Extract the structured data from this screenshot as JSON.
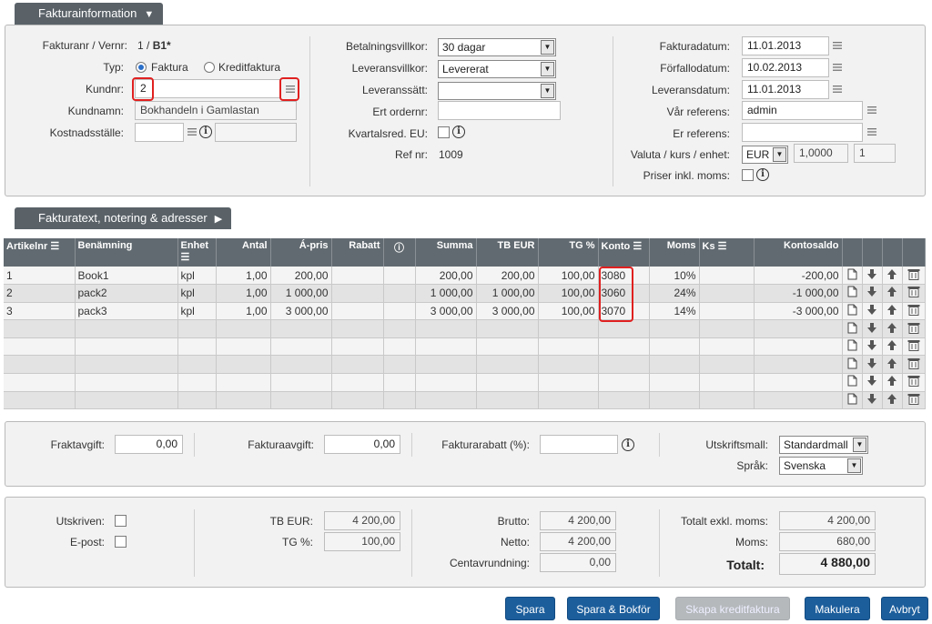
{
  "sections": {
    "info_tab": "Fakturainformation",
    "text_tab": "Fakturatext, notering & adresser"
  },
  "info": {
    "invoice_label": "Fakturanr / Vernr:",
    "invoice_num": "1 / ",
    "invoice_series": "B1*",
    "type_label": "Typ:",
    "type_faktura": "Faktura",
    "type_kredit": "Kreditfaktura",
    "kundnr_label": "Kundnr:",
    "kundnr_value": "2",
    "kundnamn_label": "Kundnamn:",
    "kundnamn_value": "Bokhandeln i Gamlastan",
    "kostnad_label": "Kostnadsställe:",
    "betal_label": "Betalningsvillkor:",
    "betal_value": "30 dagar",
    "levvill_label": "Leveransvillkor:",
    "levvill_value": "Levererat",
    "levsatt_label": "Leveranssätt:",
    "levsatt_value": "",
    "ertorder_label": "Ert ordernr:",
    "kvartal_label": "Kvartalsred. EU:",
    "refnr_label": "Ref nr:",
    "refnr_value": "1009",
    "fakturadatum_label": "Fakturadatum:",
    "fakturadatum_value": "11.01.2013",
    "forfall_label": "Förfallodatum:",
    "forfall_value": "10.02.2013",
    "levdatum_label": "Leveransdatum:",
    "levdatum_value": "11.01.2013",
    "varref_label": "Vår referens:",
    "varref_value": "admin",
    "erref_label": "Er referens:",
    "valuta_label": "Valuta / kurs / enhet:",
    "valuta_value": "EUR",
    "kurs_value": "1,0000",
    "enhet_value": "1",
    "priser_label": "Priser inkl. moms:"
  },
  "table": {
    "headers": [
      "Artikelnr",
      "Benämning",
      "Enhet",
      "Antal",
      "Á-pris",
      "Rabatt",
      "",
      "Summa",
      "TB EUR",
      "TG %",
      "Konto",
      "Moms",
      "Ks",
      "Kontosaldo"
    ],
    "rows": [
      [
        "1",
        "Book1",
        "kpl",
        "1,00",
        "200,00",
        "",
        "",
        "200,00",
        "200,00",
        "100,00",
        "3080",
        "10%",
        "",
        "-200,00"
      ],
      [
        "2",
        "pack2",
        "kpl",
        "1,00",
        "1 000,00",
        "",
        "",
        "1 000,00",
        "1 000,00",
        "100,00",
        "3060",
        "24%",
        "",
        "-1 000,00"
      ],
      [
        "3",
        "pack3",
        "kpl",
        "1,00",
        "3 000,00",
        "",
        "",
        "3 000,00",
        "3 000,00",
        "100,00",
        "3070",
        "14%",
        "",
        "-3 000,00"
      ],
      [
        "",
        "",
        "",
        "",
        "",
        "",
        "",
        "",
        "",
        "",
        "",
        "",
        "",
        ""
      ],
      [
        "",
        "",
        "",
        "",
        "",
        "",
        "",
        "",
        "",
        "",
        "",
        "",
        "",
        ""
      ],
      [
        "",
        "",
        "",
        "",
        "",
        "",
        "",
        "",
        "",
        "",
        "",
        "",
        "",
        ""
      ],
      [
        "",
        "",
        "",
        "",
        "",
        "",
        "",
        "",
        "",
        "",
        "",
        "",
        "",
        ""
      ],
      [
        "",
        "",
        "",
        "",
        "",
        "",
        "",
        "",
        "",
        "",
        "",
        "",
        "",
        ""
      ]
    ]
  },
  "fees": {
    "frakt_label": "Fraktavgift:",
    "frakt_value": "0,00",
    "faktavg_label": "Fakturaavgift:",
    "faktavg_value": "0,00",
    "rabatt_label": "Fakturarabatt (%):",
    "mall_label": "Utskriftsmall:",
    "mall_value": "Standardmall",
    "sprak_label": "Språk:",
    "sprak_value": "Svenska"
  },
  "totals": {
    "utskriven_label": "Utskriven:",
    "epost_label": "E-post:",
    "tb_label": "TB EUR:",
    "tb_value": "4 200,00",
    "tg_label": "TG %:",
    "tg_value": "100,00",
    "brutto_label": "Brutto:",
    "brutto_value": "4 200,00",
    "netto_label": "Netto:",
    "netto_value": "4 200,00",
    "cent_label": "Centavrundning:",
    "cent_value": "0,00",
    "exkl_label": "Totalt exkl. moms:",
    "exkl_value": "4 200,00",
    "moms_label": "Moms:",
    "moms_value": "680,00",
    "totalt_label": "Totalt:",
    "totalt_value": "4 880,00"
  },
  "buttons": {
    "spara": "Spara",
    "spara_bokfor": "Spara & Bokför",
    "skapa_kredit": "Skapa kreditfaktura",
    "makulera": "Makulera",
    "avbryt": "Avbryt"
  },
  "colors": {
    "button_blue": "#1c5e9c",
    "header_gray": "#616a70",
    "highlight_red": "#e02020"
  }
}
